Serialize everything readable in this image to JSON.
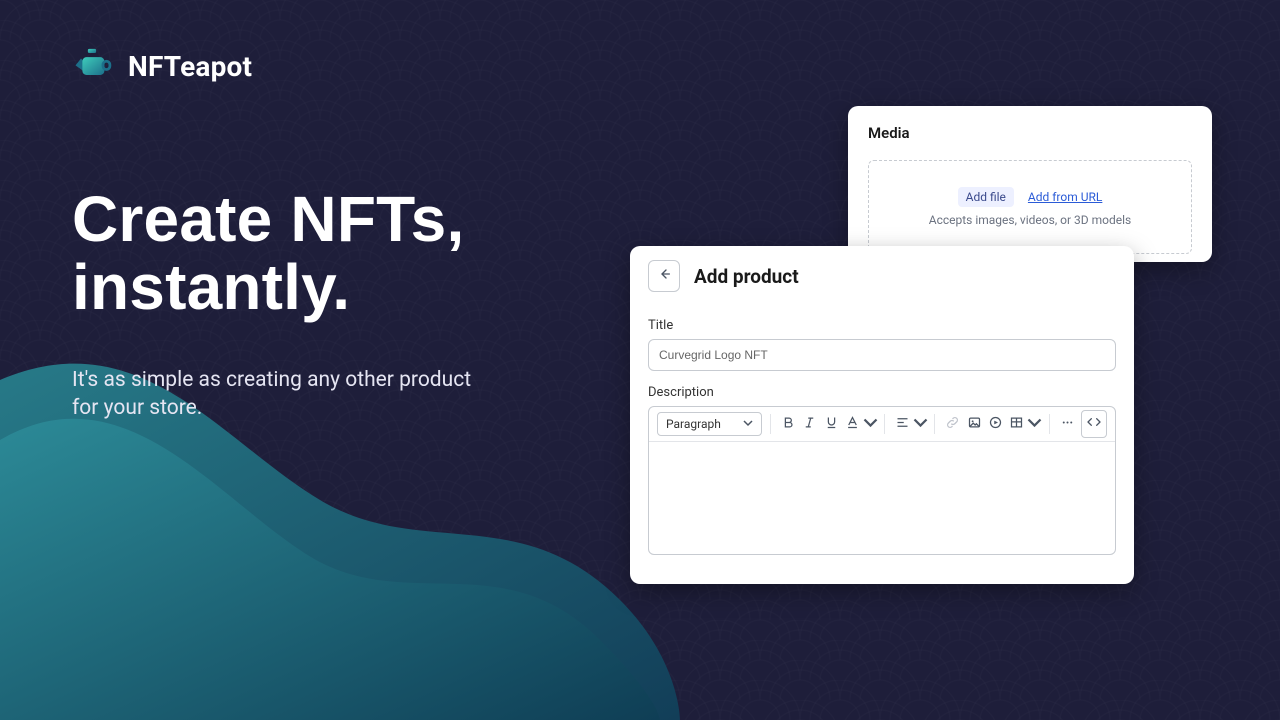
{
  "brand": {
    "name": "NFTeapot"
  },
  "hero": {
    "headline_l1": "Create NFTs,",
    "headline_l2": "instantly.",
    "sub": "It's as simple as creating any other product for your store."
  },
  "media_card": {
    "title": "Media",
    "add_file": "Add file",
    "add_url": "Add from URL",
    "hint": "Accepts images, videos, or 3D models"
  },
  "product_card": {
    "title": "Add product",
    "title_label": "Title",
    "title_value": "Curvegrid Logo NFT",
    "desc_label": "Description",
    "paragraph_label": "Paragraph"
  }
}
